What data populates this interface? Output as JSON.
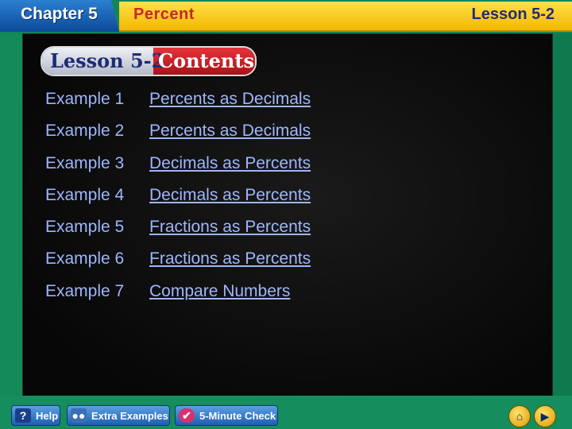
{
  "header": {
    "chapter": "Chapter 5",
    "topic": "Percent",
    "lesson": "Lesson 5-2"
  },
  "badge": {
    "lesson": "Lesson 5-2",
    "contents": "Contents"
  },
  "examples": [
    {
      "number": "Example 1",
      "title": "Percents as Decimals"
    },
    {
      "number": "Example 2",
      "title": "Percents as Decimals"
    },
    {
      "number": "Example 3",
      "title": "Decimals as Percents"
    },
    {
      "number": "Example 4",
      "title": "Decimals as Percents"
    },
    {
      "number": "Example 5",
      "title": "Fractions as Percents"
    },
    {
      "number": "Example 6",
      "title": "Fractions as Percents"
    },
    {
      "number": "Example 7",
      "title": "Compare Numbers"
    }
  ],
  "toolbar": {
    "help_label": "Help",
    "extra_examples_label": "Extra Examples",
    "five_minute_check_label": "5-Minute Check"
  },
  "icons": {
    "help": "question-icon",
    "extra_examples": "group-icon",
    "five_minute_check": "check-icon",
    "home": "home-icon",
    "next": "play-icon"
  },
  "colors": {
    "link": "#9eb6ff",
    "board": "#0b0b0b",
    "frame": "#1e8a5e",
    "title_strip": "#f4b800",
    "chapter_tab": "#0c4a9a"
  }
}
